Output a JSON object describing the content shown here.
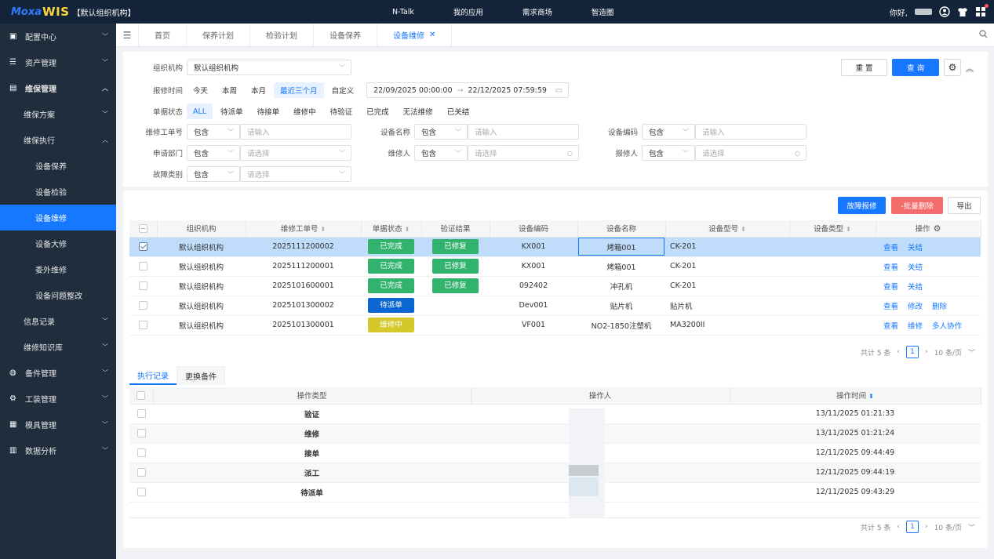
{
  "topbar": {
    "logo_prefix": "Moxa",
    "logo": "WIS",
    "org": "【默认组织机构】",
    "nav": [
      "N-Talk",
      "我的应用",
      "需求商场",
      "智造圈"
    ],
    "greeting": "你好,"
  },
  "sidebar": {
    "items": [
      {
        "label": "配置中心",
        "icon": "id-card-icon",
        "level": 0,
        "chevron": "down"
      },
      {
        "label": "资产管理",
        "icon": "list-icon",
        "level": 0,
        "chevron": "down"
      },
      {
        "label": "维保管理",
        "icon": "calendar-icon",
        "level": 0,
        "chevron": "up"
      },
      {
        "label": "维保方案",
        "level": 1,
        "chevron": "down"
      },
      {
        "label": "维保执行",
        "level": 1,
        "chevron": "up"
      },
      {
        "label": "设备保养",
        "level": 2
      },
      {
        "label": "设备检验",
        "level": 2
      },
      {
        "label": "设备维修",
        "level": 2,
        "active": true
      },
      {
        "label": "设备大修",
        "level": 2
      },
      {
        "label": "委外维修",
        "level": 2
      },
      {
        "label": "设备问题整改",
        "level": 2
      },
      {
        "label": "信息记录",
        "level": 1,
        "chevron": "down"
      },
      {
        "label": "维修知识库",
        "level": 1,
        "chevron": "down"
      },
      {
        "label": "备件管理",
        "icon": "globe-icon",
        "level": 0,
        "chevron": "down"
      },
      {
        "label": "工装管理",
        "icon": "gear-icon",
        "level": 0,
        "chevron": "down"
      },
      {
        "label": "模具管理",
        "icon": "box-icon",
        "level": 0,
        "chevron": "down"
      },
      {
        "label": "数据分析",
        "icon": "chart-icon",
        "level": 0,
        "chevron": "down"
      }
    ]
  },
  "tabs": [
    "首页",
    "保养计划",
    "检验计划",
    "设备保养",
    "设备维修"
  ],
  "filter": {
    "org_label": "组织机构",
    "org_value": "默认组织机构",
    "time_label": "报修时间",
    "time_chips": [
      "今天",
      "本周",
      "本月",
      "最近三个月",
      "自定义"
    ],
    "date_start": "22/09/2025 00:00:00",
    "date_end": "22/12/2025 07:59:59",
    "status_label": "单据状态",
    "status_chips": [
      "ALL",
      "待派单",
      "待接单",
      "维修中",
      "待验证",
      "已完成",
      "无法维修",
      "已关结"
    ],
    "f1_label": "维修工单号",
    "f1_op": "包含",
    "f1_ph": "请输入",
    "f2_label": "设备名称",
    "f2_op": "包含",
    "f2_ph": "请输入",
    "f3_label": "设备编码",
    "f3_op": "包含",
    "f3_ph": "请输入",
    "f4_label": "申请部门",
    "f4_op": "包含",
    "f4_ph": "请选择",
    "f5_label": "维修人",
    "f5_op": "包含",
    "f5_ph": "请选择",
    "f6_label": "报修人",
    "f6_op": "包含",
    "f6_ph": "请选择",
    "f7_label": "故障类别",
    "f7_op": "包含",
    "f7_ph": "请选择",
    "reset": "重 置",
    "query": "查 询"
  },
  "actions": {
    "report": "故障报修",
    "batch_delete": "-批量删除",
    "export": "导出"
  },
  "main_table": {
    "headers": [
      "组织机构",
      "维修工单号",
      "单据状态",
      "验证结果",
      "设备编码",
      "设备名称",
      "设备型号",
      "设备类型",
      "操作"
    ],
    "rows": [
      {
        "org": "默认组织机构",
        "no": "2025111200002",
        "status": "已完成",
        "status_color": "green",
        "verify": "已修复",
        "code": "KX001",
        "name": "烤箱001",
        "model": "CK-201",
        "type": "",
        "ops": [
          "查看",
          "关结"
        ],
        "selected": true
      },
      {
        "org": "默认组织机构",
        "no": "2025111200001",
        "status": "已完成",
        "status_color": "green",
        "verify": "已修复",
        "code": "KX001",
        "name": "烤箱001",
        "model": "CK-201",
        "type": "",
        "ops": [
          "查看",
          "关结"
        ],
        "selected": false
      },
      {
        "org": "默认组织机构",
        "no": "2025101600001",
        "status": "已完成",
        "status_color": "green",
        "verify": "已修复",
        "code": "092402",
        "name": "冲孔机",
        "model": "CK-201",
        "type": "",
        "ops": [
          "查看",
          "关结"
        ],
        "selected": false
      },
      {
        "org": "默认组织机构",
        "no": "2025101300002",
        "status": "待派单",
        "status_color": "blue",
        "verify": "",
        "code": "Dev001",
        "name": "贴片机",
        "model": "贴片机",
        "type": "",
        "ops": [
          "查看",
          "修改",
          "删除"
        ],
        "selected": false
      },
      {
        "org": "默认组织机构",
        "no": "2025101300001",
        "status": "维修中",
        "status_color": "yellow",
        "verify": "",
        "code": "VF001",
        "name": "NO2-1850注塑机",
        "model": "MA3200II",
        "type": "",
        "ops": [
          "查看",
          "维修",
          "多人协作"
        ],
        "selected": false
      }
    ],
    "total": "共计 5 条",
    "page": "1",
    "page_size": "10 条/页"
  },
  "sub_tabs": [
    "执行记录",
    "更换备件"
  ],
  "log_table": {
    "headers": [
      "操作类型",
      "操作人",
      "操作时间"
    ],
    "rows": [
      {
        "type": "验证",
        "time": "13/11/2025 01:21:33"
      },
      {
        "type": "维修",
        "time": "13/11/2025 01:21:24"
      },
      {
        "type": "接单",
        "time": "12/11/2025 09:44:49"
      },
      {
        "type": "派工",
        "time": "12/11/2025 09:44:19"
      },
      {
        "type": "待派单",
        "time": "12/11/2025 09:43:29"
      }
    ],
    "total": "共计 5 条",
    "page": "1",
    "page_size": "10 条/页"
  },
  "colors": {
    "accent": "#1677ff",
    "sidebar": "#1f2d3d",
    "topbar": "#13243a",
    "success": "#31b26d",
    "warning": "#d4c82a",
    "danger": "#f56c6c"
  }
}
